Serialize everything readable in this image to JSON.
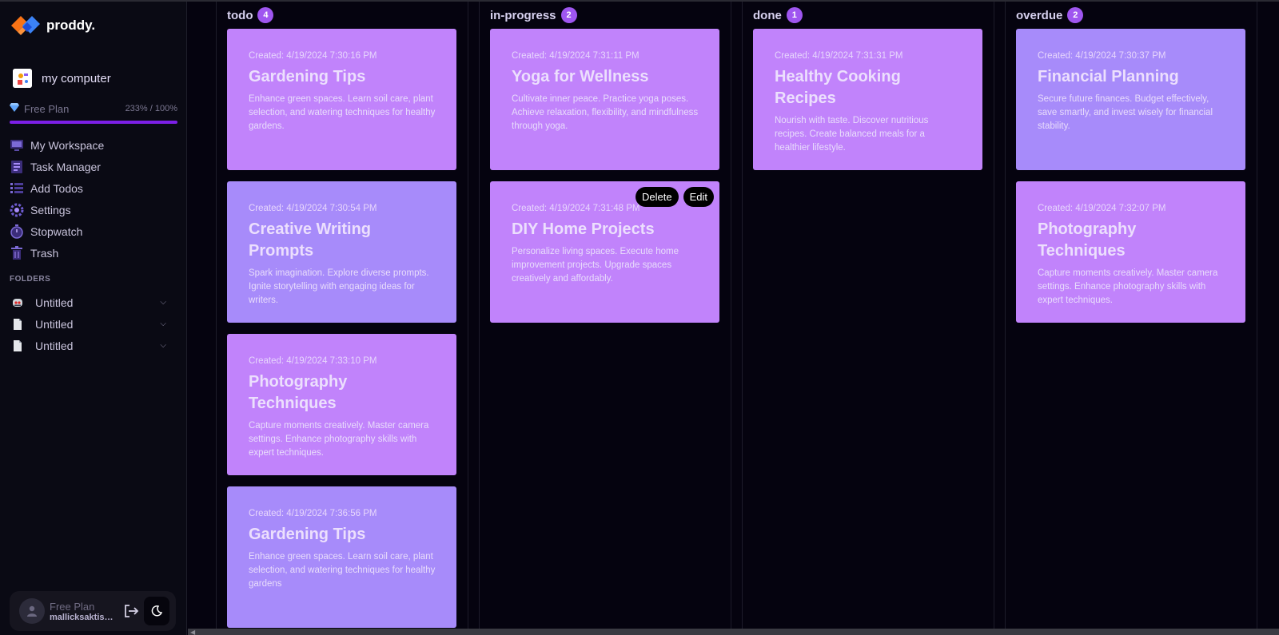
{
  "app": {
    "brand": "proddy."
  },
  "workspace": {
    "name": "my computer"
  },
  "plan": {
    "label": "Free Plan",
    "usage": "233% / 100%",
    "fill_fraction": 1.0
  },
  "nav": [
    {
      "label": "My Workspace",
      "icon": "workspace-icon"
    },
    {
      "label": "Task Manager",
      "icon": "task-manager-icon"
    },
    {
      "label": "Add Todos",
      "icon": "add-todos-icon"
    },
    {
      "label": "Settings",
      "icon": "settings-icon"
    },
    {
      "label": "Stopwatch",
      "icon": "stopwatch-icon"
    },
    {
      "label": "Trash",
      "icon": "trash-icon"
    }
  ],
  "folders": {
    "title": "FOLDERS",
    "items": [
      {
        "label": "Untitled",
        "icon": "robot-emoji-icon"
      },
      {
        "label": "Untitled",
        "icon": "document-icon"
      },
      {
        "label": "Untitled",
        "icon": "document-icon"
      }
    ]
  },
  "user": {
    "plan": "Free Plan",
    "email": "mallicksaktiswa..."
  },
  "colors": {
    "accent": "#7c1fe6",
    "badge": "#9f56f0",
    "card_pink": "#c183fb",
    "card_lavender": "#a78bfa"
  },
  "columns": [
    {
      "title": "todo",
      "count": "4",
      "cards": [
        {
          "date": "Created: 4/19/2024 7:30:16 PM",
          "title": "Gardening Tips",
          "desc": "Enhance green spaces. Learn soil care, plant selection, and watering techniques for healthy gardens.",
          "color": "pink"
        },
        {
          "date": "Created: 4/19/2024 7:30:54 PM",
          "title": "Creative Writing Prompts",
          "desc": "Spark imagination. Explore diverse prompts. Ignite storytelling with engaging ideas for writers.",
          "color": "lavender"
        },
        {
          "date": "Created: 4/19/2024 7:33:10 PM",
          "title": "Photography Techniques",
          "desc": "Capture moments creatively. Master camera settings. Enhance photography skills with expert techniques.",
          "color": "pink"
        },
        {
          "date": "Created: 4/19/2024 7:36:56 PM",
          "title": "Gardening Tips",
          "desc": "Enhance green spaces. Learn soil care, plant selection, and watering techniques for healthy gardens",
          "color": "lavender"
        }
      ]
    },
    {
      "title": "in-progress",
      "count": "2",
      "cards": [
        {
          "date": "Created: 4/19/2024 7:31:11 PM",
          "title": "Yoga for Wellness",
          "desc": "Cultivate inner peace. Practice yoga poses. Achieve relaxation, flexibility, and mindfulness through yoga.",
          "color": "pink"
        },
        {
          "date": "Created: 4/19/2024 7:31:48 PM",
          "title": "DIY Home Projects",
          "desc": "Personalize living spaces. Execute home improvement projects. Upgrade spaces creatively and affordably.",
          "color": "pink",
          "actions": {
            "delete": "Delete",
            "edit": "Edit"
          }
        }
      ]
    },
    {
      "title": "done",
      "count": "1",
      "cards": [
        {
          "date": "Created: 4/19/2024 7:31:31 PM",
          "title": "Healthy Cooking Recipes",
          "desc": "Nourish with taste. Discover nutritious recipes. Create balanced meals for a healthier lifestyle.",
          "color": "pink"
        }
      ]
    },
    {
      "title": "overdue",
      "count": "2",
      "cards": [
        {
          "date": "Created: 4/19/2024 7:30:37 PM",
          "title": "Financial Planning",
          "desc": "Secure future finances. Budget effectively, save smartly, and invest wisely for financial stability.",
          "color": "lavender"
        },
        {
          "date": "Created: 4/19/2024 7:32:07 PM",
          "title": "Photography Techniques",
          "desc": "Capture moments creatively. Master camera settings. Enhance photography skills with expert techniques.",
          "color": "pink"
        }
      ]
    }
  ]
}
